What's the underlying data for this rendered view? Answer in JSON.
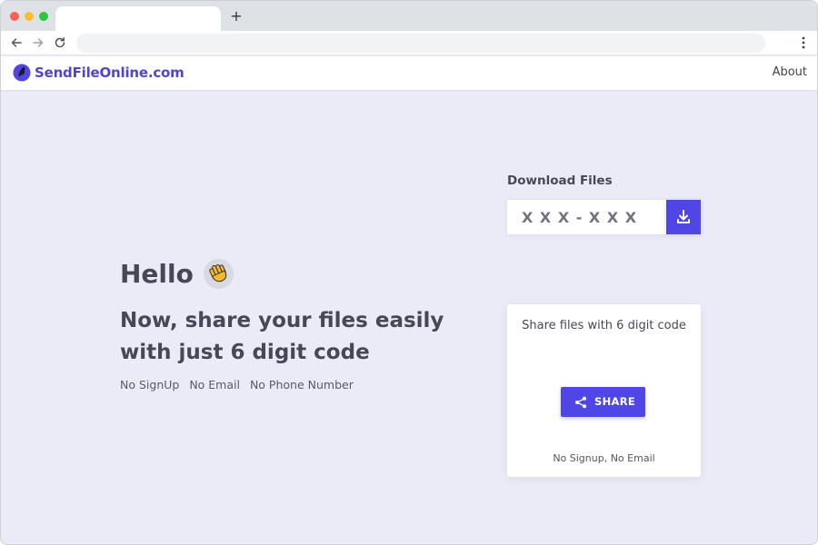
{
  "browser": {
    "new_tab_symbol": "+",
    "back_icon": "arrow-left-icon",
    "forward_icon": "arrow-right-icon",
    "reload_icon": "reload-icon",
    "menu_icon": "vertical-dots-icon",
    "address_value": ""
  },
  "site": {
    "logo_text": "SendFileOnline.com",
    "logo_icon": "logo-icon",
    "nav": {
      "about_label": "About"
    }
  },
  "hero": {
    "greeting": "Hello",
    "greeting_icon": "waving-hand-icon",
    "headline": "Now, share your files easily with just 6 digit code",
    "tags": [
      "No SignUp",
      "No Email",
      "No Phone Number"
    ]
  },
  "download": {
    "title": "Download Files",
    "code_placeholder": "X X X - X X X",
    "code_value": "",
    "button_icon": "download-icon"
  },
  "share": {
    "title": "Share files with 6 digit code",
    "button_label": "SHARE",
    "button_icon": "share-icon",
    "note": "No Signup, No Email"
  },
  "colors": {
    "brand": "#4f46e5",
    "logo_text": "#4f46c8",
    "page_background": "#ebebf8",
    "heading_text": "#474756"
  }
}
